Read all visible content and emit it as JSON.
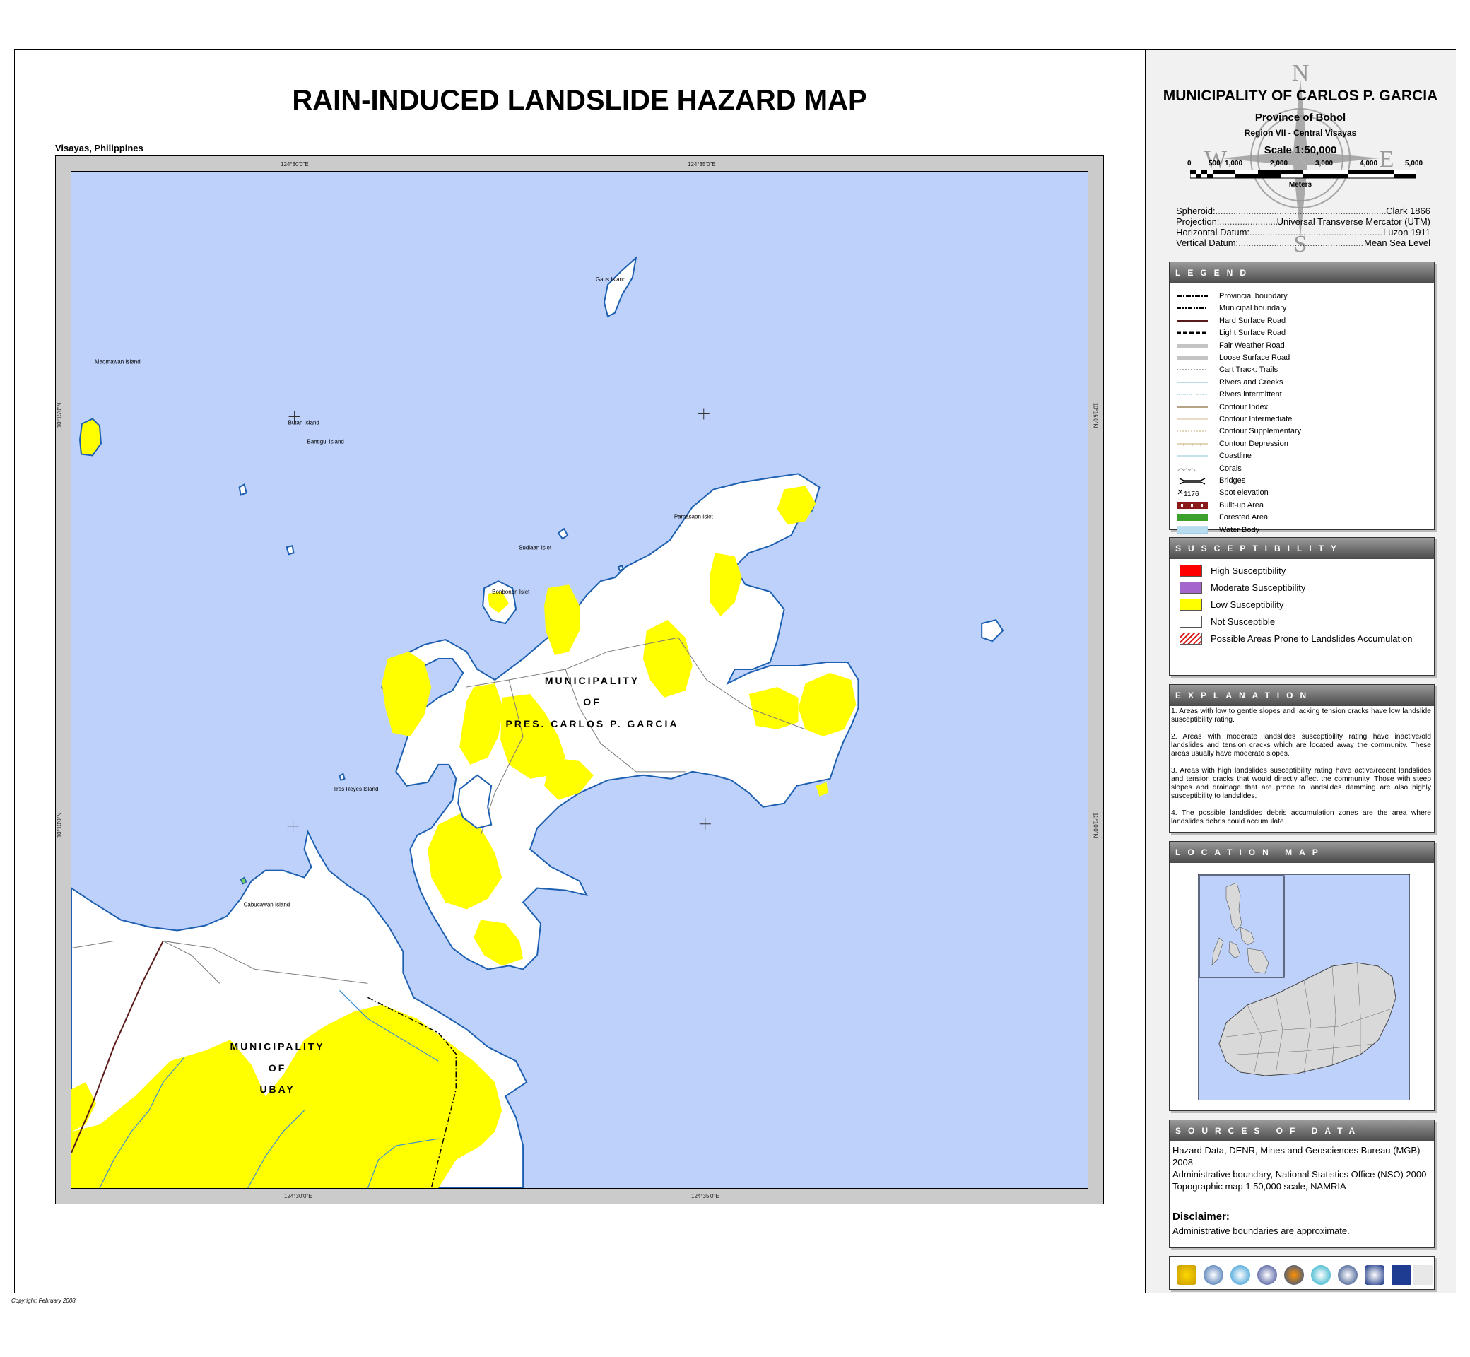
{
  "title": "RAIN-INDUCED LANDSLIDE HAZARD MAP",
  "region_label": "Visayas, Philippines",
  "copyright": "Copyright: February 2008",
  "map": {
    "coords": {
      "top_left": "124°30'0\"E",
      "top_right": "124°35'0\"E",
      "bottom_left": "124°30'0\"E",
      "bottom_right": "124°35'0\"E",
      "left_top": "10°15'0\"N",
      "left_bottom": "10°10'0\"N",
      "right_top": "10°15'0\"N",
      "right_bottom": "10°10'0\"N"
    },
    "places": {
      "gaus": "Gaus Island",
      "maomawan": "Maomawan Island",
      "butan": "Butan Island",
      "bantigui": "Bantigui Island",
      "pamasaon": "Pamasaon Islet",
      "sudlaan": "Sudlaan Islet",
      "bonbonon": "Bonbonon Islet",
      "tres_reyes": "Tres Reyes Island",
      "cabucawan": "Cabucawan Island"
    },
    "municipality_1": {
      "line1": "MUNICIPALITY",
      "line2": "OF",
      "line3": "PRES. CARLOS P. GARCIA"
    },
    "municipality_2": {
      "line1": "MUNICIPALITY",
      "line2": "OF",
      "line3": "UBAY"
    }
  },
  "panel": {
    "municipality_title": "MUNICIPALITY OF CARLOS P. GARCIA",
    "province": "Province of Bohol",
    "region": "Region VII - Central Visayas",
    "scale": "Scale 1:50,000",
    "scale_numbers": [
      "0",
      "500",
      "1,000",
      "2,000",
      "3,000",
      "4,000",
      "5,000"
    ],
    "scale_units": "Meters",
    "compass": {
      "n": "N",
      "s": "S",
      "e": "E",
      "w": "W"
    },
    "projection_info": [
      {
        "label": "Spheroid:",
        "value": "Clark 1866"
      },
      {
        "label": "Projection:",
        "value": "Universal Transverse Mercator (UTM)"
      },
      {
        "label": "Horizontal Datum:",
        "value": "Luzon 1911"
      },
      {
        "label": "Vertical Datum:",
        "value": "Mean Sea Level"
      }
    ],
    "legend": {
      "heading": "LEGEND",
      "items": [
        {
          "label": "Provincial boundary",
          "style": "dashdot"
        },
        {
          "label": "Municipal boundary",
          "style": "dashdotdot"
        },
        {
          "label": "Hard Surface Road",
          "style": "hard"
        },
        {
          "label": "Light Surface Road",
          "style": "light"
        },
        {
          "label": "Fair Weather Road",
          "style": "fair"
        },
        {
          "label": "Loose Surface Road",
          "style": "loose"
        },
        {
          "label": "Cart Track: Trails",
          "style": "dotted"
        },
        {
          "label": "Rivers and Creeks",
          "style": "river"
        },
        {
          "label": "Rivers intermittent",
          "style": "riverint"
        },
        {
          "label": "Contour Index",
          "style": "cindex"
        },
        {
          "label": "Contour Intermediate",
          "style": "cinter"
        },
        {
          "label": "Contour Supplementary",
          "style": "csupp"
        },
        {
          "label": "Contour Depression",
          "style": "cdep"
        },
        {
          "label": "Coastline",
          "style": "coast"
        },
        {
          "label": "Corals",
          "style": "corals"
        },
        {
          "label": "Bridges",
          "style": "bridge"
        },
        {
          "label": "Spot elevation",
          "style": "spot"
        },
        {
          "label": "Built-up Area",
          "style": "builtup"
        },
        {
          "label": "Forested Area",
          "style": "forest"
        },
        {
          "label": "Water Body",
          "style": "water"
        }
      ],
      "spot_value": "1176"
    },
    "susceptibility": {
      "heading": "SUSCEPTIBILITY",
      "items": [
        {
          "label": "High Susceptibility",
          "color": "#ff0000"
        },
        {
          "label": "Moderate Susceptibility",
          "color": "#a566cc"
        },
        {
          "label": "Low Susceptibility",
          "color": "#ffff00"
        },
        {
          "label": "Not Susceptible",
          "color": "#ffffff"
        },
        {
          "label": "Possible Areas Prone to Landslides Accumulation",
          "color": "hatch"
        }
      ]
    },
    "explanation": {
      "heading": "EXPLANATION",
      "paragraphs": [
        "1. Areas with low to gentle slopes and lacking tension cracks have low landslide susceptibility rating.",
        "2. Areas with moderate landslides susceptibility rating have inactive/old landslides and tension cracks which are located away the community. These areas usually have moderate slopes.",
        "3. Areas with high landslides susceptibility rating have active/recent landslides and tension cracks that would directly affect the community. Those with steep slopes and drainage that are prone to landslides damming are also highly susceptibility to landslides.",
        "4. The possible landslides debris accumulation zones are the area where landslides debris could accumulate."
      ]
    },
    "location_map": {
      "heading": "LOCATION MAP"
    },
    "sources": {
      "heading": "SOURCES OF DATA",
      "lines": [
        "Hazard Data, DENR, Mines and Geosciences Bureau (MGB) 2008",
        "Administrative boundary, National Statistics Office (NSO) 2000",
        "Topographic map 1:50,000 scale,  NAMRIA"
      ],
      "disclaimer_heading": "Disclaimer:",
      "disclaimer_text": "Administrative boundaries are approximate."
    }
  },
  "colors": {
    "sea": "#bdd1fb",
    "low": "#ffff00",
    "coast": "#1d5fb0",
    "land": "#ffffff"
  }
}
